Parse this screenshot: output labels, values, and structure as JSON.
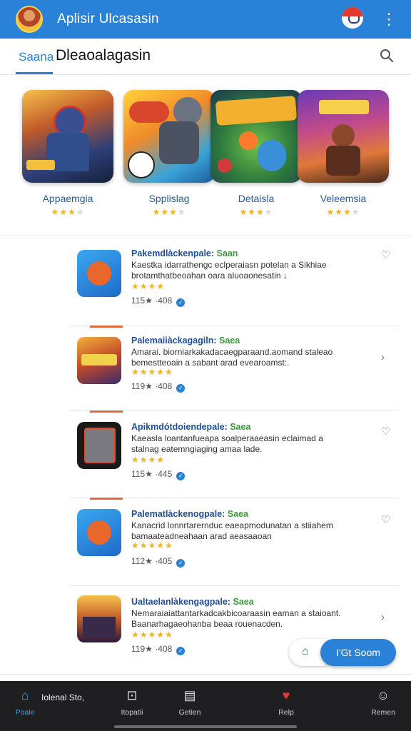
{
  "header": {
    "title": "Aplisir Ulcasasin",
    "avatar": "avatar-icon",
    "badge": "mascot-icon",
    "menu_glyph": "⋮"
  },
  "search": {
    "tab_label": "Saana",
    "title": "Dleaoalagasin"
  },
  "featured": [
    {
      "name": "Appaemgia",
      "stars": "★★★",
      "dim": "★"
    },
    {
      "name": "Spplislag",
      "stars": "★★★",
      "dim": "★"
    },
    {
      "name": "Detaisla",
      "stars": "★★★",
      "dim": "★"
    },
    {
      "name": "Veleemsia",
      "stars": "★★★",
      "dim": "★"
    }
  ],
  "list": [
    {
      "title": "Pakemdlàckenpale:",
      "tag": "Saan",
      "desc": "Kaestka idarrathengc eclperaiasn potelan a Sikhiae brotamthatbeoahan oara aluoaonesatin ↓",
      "stars": "★★★★",
      "meta": "115★ ·408",
      "action": "♡"
    },
    {
      "title": "Palemaiiàckagagiln:",
      "tag": "Saea",
      "desc": "Amarai. biorniarkakadacaegparaand.aomand staleao bemestteoain a sabant arad evearoamst:.",
      "stars": "★★★★★",
      "meta": "119★ ·408",
      "action": "›"
    },
    {
      "title": "Apikmdótdoiendepale:",
      "tag": "Saea",
      "desc": "Kaeasla loantanfueapa soalperaaeasin eclaimad a stalnag eatemngiaging amaa lade.",
      "stars": "★★★★",
      "meta": "115★ ·445",
      "action": "♡"
    },
    {
      "title": "Palematlàckenogpale:",
      "tag": "Saea",
      "desc": "Kanacrid lonnrtarernduc eaeapmodunatan a stiiahem bamaateadneahaan arad aeasaaoan",
      "stars": "★★★★★",
      "meta": "112★ ·405",
      "action": "♡"
    },
    {
      "title": "Ualtaelanlàkengagpale:",
      "tag": "Saea",
      "desc": "Nemaraiaiattantarkadcakbicoaraasin eaman a staioant. Baanarhagaeohanba beaa rouenacden.",
      "stars": "★★★★★",
      "meta": "119★ ·408",
      "action": "›"
    }
  ],
  "fab": {
    "label": "I'Gt Soom",
    "secondary_glyph": "⌂"
  },
  "bottom_nav": {
    "extra": "Iolenal Sto,",
    "items": [
      {
        "label": "Poale",
        "glyph": "⌂",
        "icon": "home-icon"
      },
      {
        "label": "Itopatii",
        "glyph": "⊡",
        "icon": "library-icon"
      },
      {
        "label": "Getien",
        "glyph": "▤",
        "icon": "list-icon"
      },
      {
        "label": "Relp",
        "glyph": "♥",
        "icon": "favorite-icon"
      },
      {
        "label": "Remen",
        "glyph": "☺",
        "icon": "profile-icon"
      }
    ]
  },
  "colors": {
    "primary": "#2a82d8",
    "star": "#f2b424",
    "accent": "#e06a3a",
    "nav_bg": "#1f1f22"
  }
}
